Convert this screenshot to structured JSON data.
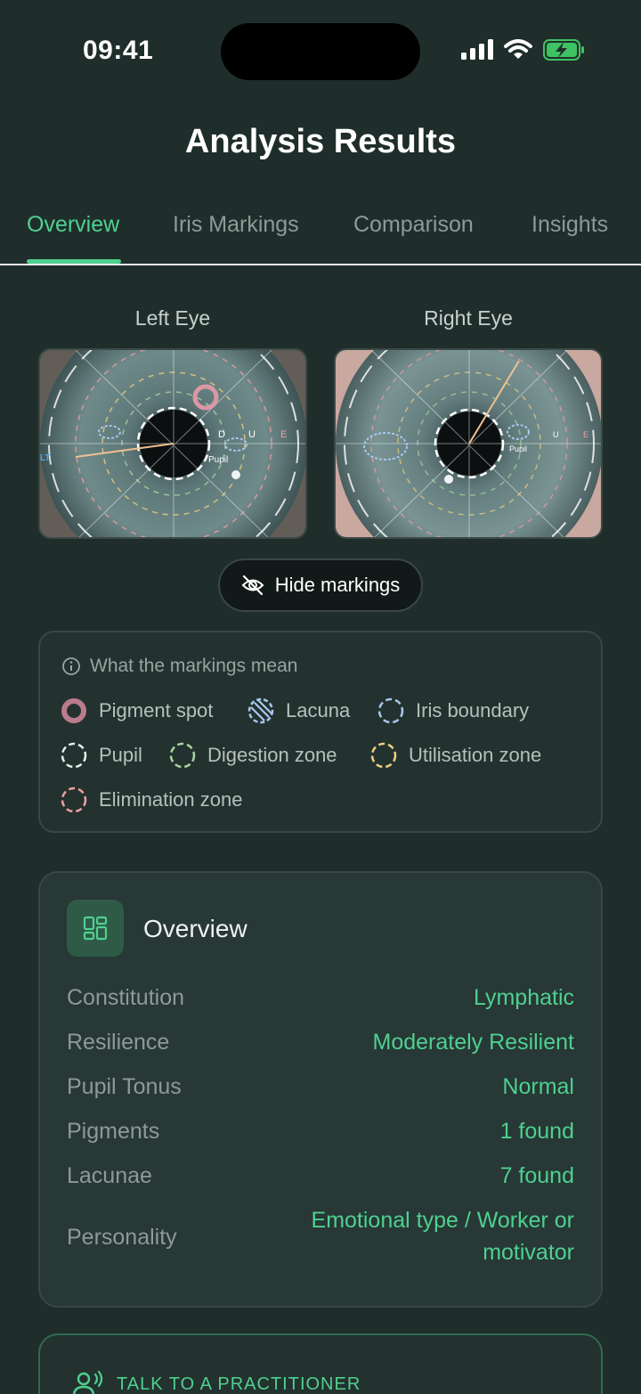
{
  "status": {
    "time": "09:41"
  },
  "title": "Analysis Results",
  "tabs": [
    {
      "label": "Overview",
      "active": true
    },
    {
      "label": "Iris Markings",
      "active": false
    },
    {
      "label": "Comparison",
      "active": false
    },
    {
      "label": "Insights",
      "active": false
    }
  ],
  "eyes": {
    "left_label": "Left Eye",
    "right_label": "Right Eye",
    "left_markers": {
      "pupil": "Pupil",
      "lt": "LT",
      "d": "D",
      "u": "U",
      "e": "E"
    },
    "right_markers": {
      "pupil": "Pupil",
      "u": "U",
      "e": "E"
    }
  },
  "hide_button": {
    "label": "Hide markings",
    "icon": "eye-off-icon"
  },
  "legend": {
    "heading": "What the markings mean",
    "items": [
      {
        "label": "Pigment spot",
        "icon": "pigment-spot-icon",
        "color": "#d9a0b0"
      },
      {
        "label": "Lacuna",
        "icon": "lacuna-icon",
        "color": "#a9c7ef"
      },
      {
        "label": "Iris boundary",
        "icon": "iris-boundary-icon",
        "color": "#a9c7ef"
      },
      {
        "label": "Pupil",
        "icon": "pupil-icon",
        "color": "#e8eeec"
      },
      {
        "label": "Digestion zone",
        "icon": "digestion-zone-icon",
        "color": "#a9d6a0"
      },
      {
        "label": "Utilisation zone",
        "icon": "utilisation-zone-icon",
        "color": "#f0d080"
      },
      {
        "label": "Elimination zone",
        "icon": "elimination-zone-icon",
        "color": "#f0a0a0"
      }
    ]
  },
  "overview": {
    "title": "Overview",
    "icon": "dashboard-icon",
    "rows": [
      {
        "label": "Constitution",
        "value": "Lymphatic"
      },
      {
        "label": "Resilience",
        "value": "Moderately Resilient"
      },
      {
        "label": "Pupil Tonus",
        "value": "Normal"
      },
      {
        "label": "Pigments",
        "value": "1 found"
      },
      {
        "label": "Lacunae",
        "value": "7 found"
      },
      {
        "label": "Personality",
        "value_line1": "Emotional type / Worker or",
        "value_line2": "motivator"
      }
    ]
  },
  "practitioner": {
    "label": "TALK TO A PRACTITIONER",
    "icon": "practitioner-icon"
  },
  "colors": {
    "accent": "#4fd08f",
    "background": "#1f2e2b"
  }
}
